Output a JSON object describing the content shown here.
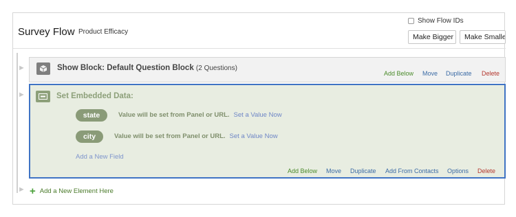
{
  "header": {
    "title": "Survey Flow",
    "subtitle": "Product Efficacy",
    "show_flow_ids_label": "Show Flow IDs",
    "make_bigger_label": "Make Bigger",
    "make_smaller_label": "Make Smaller"
  },
  "block": {
    "title": "Show Block: Default Question Block",
    "count": "(2 Questions)",
    "actions": {
      "add_below": "Add Below",
      "move": "Move",
      "duplicate": "Duplicate",
      "delete": "Delete"
    }
  },
  "embedded": {
    "title": "Set Embedded Data:",
    "fields": [
      {
        "name": "state",
        "text": "Value will be set from Panel or URL.",
        "link": "Set a Value Now"
      },
      {
        "name": "city",
        "text": "Value will be set from Panel or URL.",
        "link": "Set a Value Now"
      }
    ],
    "add_field": "Add a New Field",
    "actions": {
      "add_below": "Add Below",
      "move": "Move",
      "duplicate": "Duplicate",
      "add_from_contacts": "Add From Contacts",
      "options": "Options",
      "delete": "Delete"
    }
  },
  "footer": {
    "add_element": "Add a New Element Here"
  },
  "colors": {
    "accent_blue": "#3f73c4",
    "green": "#4a8a2a",
    "red": "#b3362d",
    "embed_bg": "#e8ede1"
  },
  "icons": [
    "cube-icon",
    "embedded-data-icon",
    "plus-icon",
    "arrow-icon"
  ]
}
